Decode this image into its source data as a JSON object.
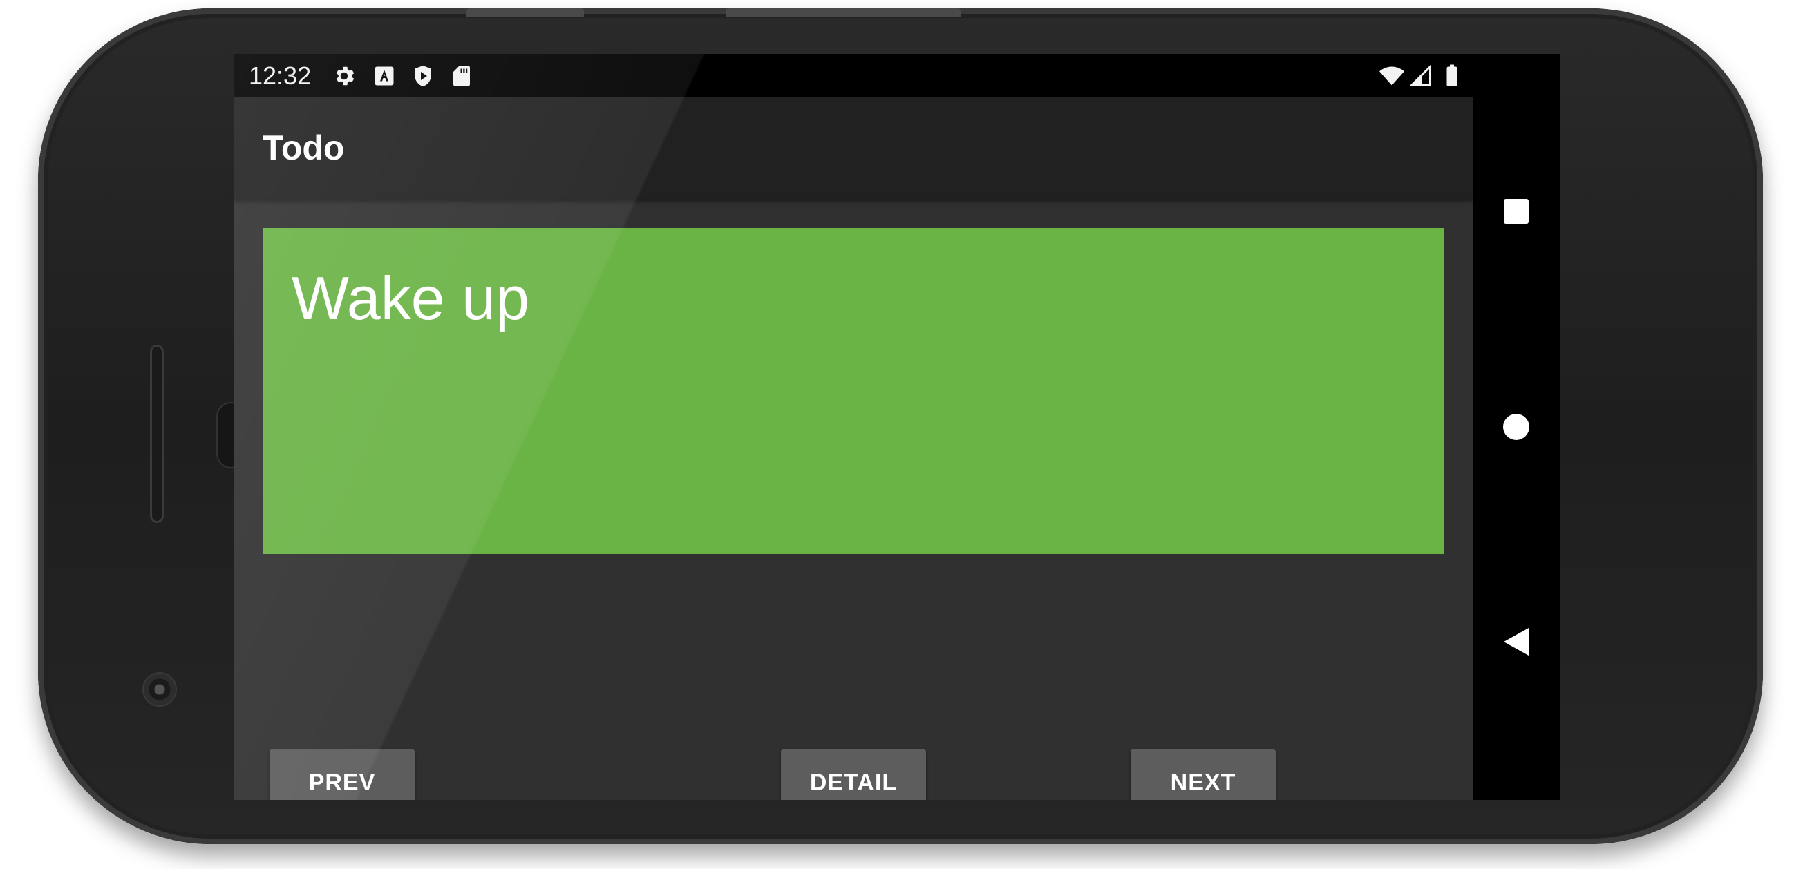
{
  "status_bar": {
    "time": "12:32",
    "left_icons": [
      "gear-icon",
      "font-a-icon",
      "shield-play-icon",
      "sd-card-icon"
    ],
    "right_icons": [
      "wifi-icon",
      "cellular-signal-icon",
      "battery-icon"
    ]
  },
  "toolbar": {
    "title": "Todo"
  },
  "todo": {
    "text": "Wake up",
    "card_color": "#6ab345"
  },
  "buttons": {
    "prev_label": "PREV",
    "detail_label": "DETAIL",
    "next_label": "NEXT"
  },
  "nav_bar": {
    "icons": [
      "recents-icon",
      "home-icon",
      "back-icon"
    ]
  },
  "colors": {
    "app_background": "#303030",
    "toolbar_background": "#212121",
    "button_background": "#5d5d5d"
  }
}
